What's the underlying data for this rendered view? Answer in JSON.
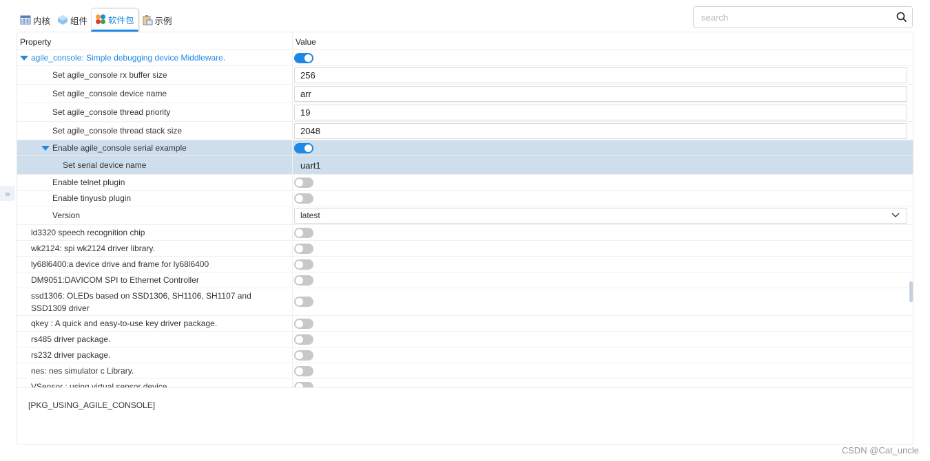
{
  "tabs": [
    {
      "label": "内核",
      "icon": "table-icon"
    },
    {
      "label": "组件",
      "icon": "cube-icon"
    },
    {
      "label": "软件包",
      "icon": "packages-icon",
      "active": true
    },
    {
      "label": "示例",
      "icon": "clipboard-icon"
    }
  ],
  "search": {
    "placeholder": "search",
    "value": ""
  },
  "header": {
    "property": "Property",
    "value": "Value"
  },
  "accent": "#1e88e5",
  "rows": [
    {
      "label": "agile_console: Simple debugging device Middleware.",
      "type": "toggle",
      "on": true,
      "indent": 1,
      "expanded": true,
      "highlight": true
    },
    {
      "label": "Set agile_console rx buffer size",
      "type": "input",
      "value": "256",
      "indent": 2
    },
    {
      "label": "Set agile_console device name",
      "type": "input",
      "value": "arr",
      "indent": 2
    },
    {
      "label": "Set agile_console thread priority",
      "type": "input",
      "value": "19",
      "indent": 2
    },
    {
      "label": "Set agile_console thread stack size",
      "type": "input",
      "value": "2048",
      "indent": 2
    },
    {
      "label": "Enable agile_console serial example",
      "type": "toggle",
      "on": true,
      "indent": 2,
      "expanded": true,
      "selected": true
    },
    {
      "label": "Set serial device name",
      "type": "input",
      "value": "uart1",
      "indent": 3,
      "selected": true
    },
    {
      "label": "Enable telnet plugin",
      "type": "toggle",
      "on": false,
      "indent": 2
    },
    {
      "label": "Enable tinyusb plugin",
      "type": "toggle",
      "on": false,
      "indent": 2
    },
    {
      "label": "Version",
      "type": "select",
      "value": "latest",
      "indent": 2
    },
    {
      "label": "ld3320 speech recognition chip",
      "type": "toggle",
      "on": false,
      "indent": 1
    },
    {
      "label": "wk2124: spi wk2124 driver library.",
      "type": "toggle",
      "on": false,
      "indent": 1
    },
    {
      "label": "ly68l6400:a device drive and frame for ly68l6400",
      "type": "toggle",
      "on": false,
      "indent": 1
    },
    {
      "label": "DM9051:DAVICOM SPI to Ethernet Controller",
      "type": "toggle",
      "on": false,
      "indent": 1
    },
    {
      "label": "ssd1306: OLEDs based on SSD1306, SH1106, SH1107 and SSD1309 driver",
      "type": "toggle",
      "on": false,
      "indent": 1
    },
    {
      "label": "qkey : A quick and easy-to-use key driver package.",
      "type": "toggle",
      "on": false,
      "indent": 1
    },
    {
      "label": "rs485 driver package.",
      "type": "toggle",
      "on": false,
      "indent": 1
    },
    {
      "label": "rs232 driver package.",
      "type": "toggle",
      "on": false,
      "indent": 1
    },
    {
      "label": "nes: nes simulator c Library.",
      "type": "toggle",
      "on": false,
      "indent": 1
    },
    {
      "label": "VSensor : using virtual sensor device",
      "type": "toggle",
      "on": false,
      "indent": 1
    }
  ],
  "description": "[PKG_USING_AGILE_CONSOLE]",
  "watermark": "CSDN @Cat_uncle"
}
